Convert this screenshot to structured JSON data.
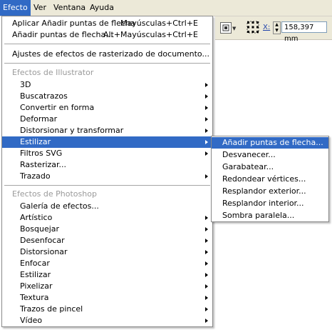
{
  "menubar": {
    "items": [
      {
        "label": "Efecto",
        "active": true
      },
      {
        "label": "Ver",
        "active": false
      },
      {
        "label": "Ventana",
        "active": false
      },
      {
        "label": "Ayuda",
        "active": false
      }
    ]
  },
  "toolbar": {
    "x_label": "X:",
    "x_value": "158,397 mm"
  },
  "menu": {
    "apply_effect": {
      "label": "Aplicar Añadir puntas de flecha",
      "shortcut": "Mayúsculas+Ctrl+E"
    },
    "add_effect": {
      "label": "Añadir puntas de flecha...",
      "shortcut": "Alt+Mayúsculas+Ctrl+E"
    },
    "raster_settings": "Ajustes de efectos de rasterizado de documento...",
    "illustrator_header": "Efectos de Illustrator",
    "illustrator_items": [
      {
        "label": "3D"
      },
      {
        "label": "Buscatrazos"
      },
      {
        "label": "Convertir en forma"
      },
      {
        "label": "Deformar"
      },
      {
        "label": "Distorsionar y transformar"
      },
      {
        "label": "Estilizar"
      },
      {
        "label": "Filtros SVG"
      },
      {
        "label": "Rasterizar..."
      },
      {
        "label": "Trazado"
      }
    ],
    "photoshop_header": "Efectos de Photoshop",
    "photoshop_items": [
      {
        "label": "Galería de efectos..."
      },
      {
        "label": "Artístico"
      },
      {
        "label": "Bosquejar"
      },
      {
        "label": "Desenfocar"
      },
      {
        "label": "Distorsionar"
      },
      {
        "label": "Enfocar"
      },
      {
        "label": "Estilizar"
      },
      {
        "label": "Pixelizar"
      },
      {
        "label": "Textura"
      },
      {
        "label": "Trazos de pincel"
      },
      {
        "label": "Vídeo"
      }
    ]
  },
  "submenu": {
    "items": [
      {
        "label": "Añadir puntas de flecha..."
      },
      {
        "label": "Desvanecer..."
      },
      {
        "label": "Garabatear..."
      },
      {
        "label": "Redondear vértices..."
      },
      {
        "label": "Resplandor exterior..."
      },
      {
        "label": "Resplandor interior..."
      },
      {
        "label": "Sombra paralela..."
      }
    ]
  },
  "colors": {
    "highlight": "#316ac5",
    "menubar_bg": "#ece9d8",
    "section_text": "#9a9a9a"
  }
}
